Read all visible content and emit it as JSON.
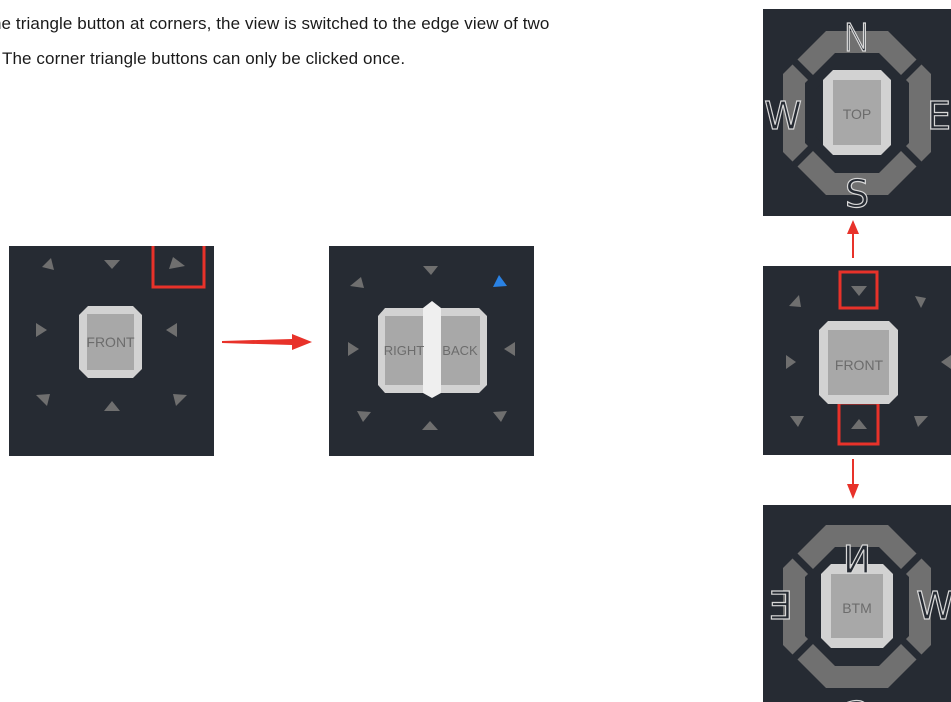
{
  "description": {
    "line1": "he triangle button at corners, the view is switched to the edge view of two",
    "line2": "The corner triangle buttons can only be clicked once."
  },
  "panels": {
    "front_before": {
      "face_label": "FRONT"
    },
    "edge_view": {
      "left_label": "RIGHT",
      "right_label": "BACK"
    },
    "top_view": {
      "face_label": "TOP",
      "n": "N",
      "s": "S",
      "w": "W",
      "e": "E"
    },
    "front_middle": {
      "face_label": "FRONT"
    },
    "bottom_view": {
      "face_label": "BTM",
      "n": "N",
      "s": "S",
      "w": "W",
      "e": "E"
    }
  },
  "colors": {
    "panel_bg": "#262b33",
    "triangle": "#6f6f6f",
    "highlight_box": "#e8322a",
    "selected_triangle": "#2a82e4",
    "arrow": "#e8322a",
    "ring": "#707070"
  }
}
